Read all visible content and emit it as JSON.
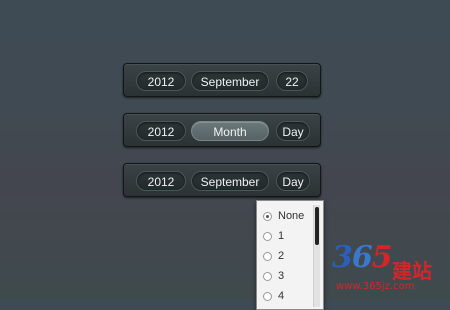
{
  "picker1": {
    "year": "2012",
    "month": "September",
    "day": "22"
  },
  "picker2": {
    "year": "2012",
    "month": "Month",
    "day": "Day"
  },
  "picker3": {
    "year": "2012",
    "month": "September",
    "day": "Day"
  },
  "day_dropdown": {
    "options": [
      "None",
      "1",
      "2",
      "3",
      "4"
    ],
    "selected": "None"
  },
  "watermark": {
    "digit1": "3",
    "digit2": "6",
    "digit3": "5",
    "chinese": "建站",
    "url": "www.365jz.com"
  }
}
